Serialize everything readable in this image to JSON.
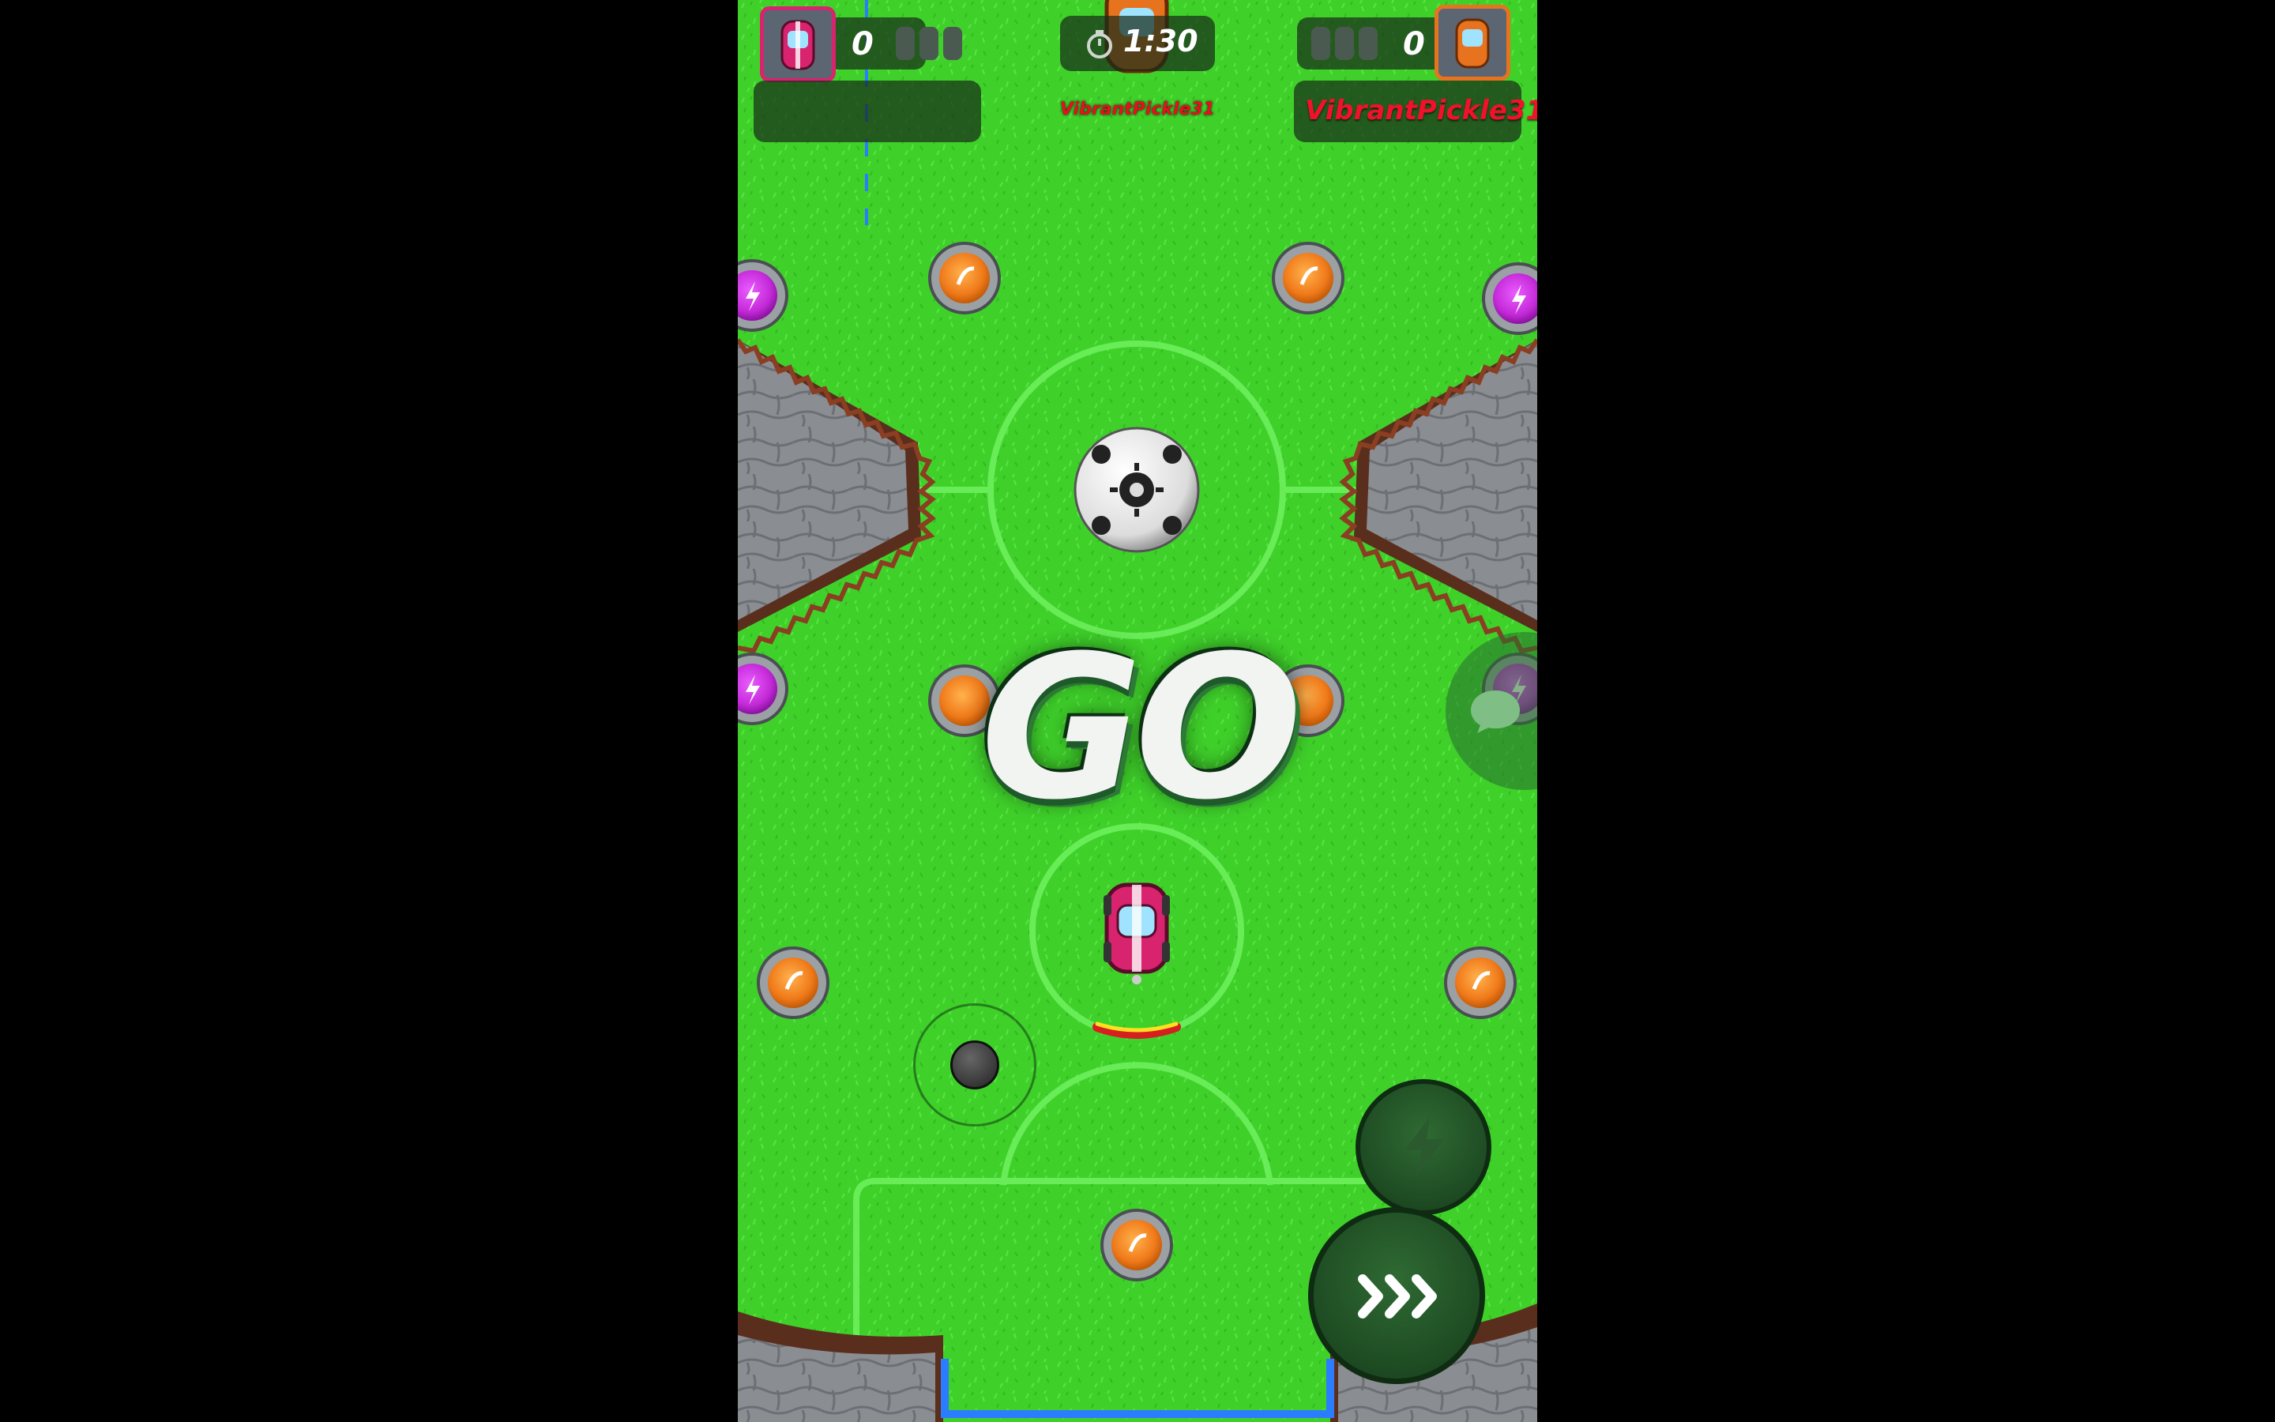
{
  "hud": {
    "left_player": {
      "score": "0",
      "pips_filled": 0,
      "pips_total": 3,
      "name": ""
    },
    "right_player": {
      "score": "0",
      "pips_filled": 0,
      "pips_total": 3,
      "name": "VibrantPickle31"
    },
    "timer": "1:30",
    "top_label": "VibrantPickle31"
  },
  "overlay": {
    "go_text": "GO"
  },
  "colors": {
    "grass": "#3fd12a",
    "grass_stripe": "#4be03a",
    "left_team": "#d8236e",
    "right_team": "#e8731f",
    "boost_orb": "#f07a1a",
    "power_orb": "#c42ad8",
    "goal_line": "#2b7cff"
  },
  "controls": {
    "joystick_icon": "joystick-icon",
    "power_icon": "lightning-icon",
    "boost_icon": "triple-chevron-right-icon",
    "chat_icon": "chat-bubble-icon"
  }
}
